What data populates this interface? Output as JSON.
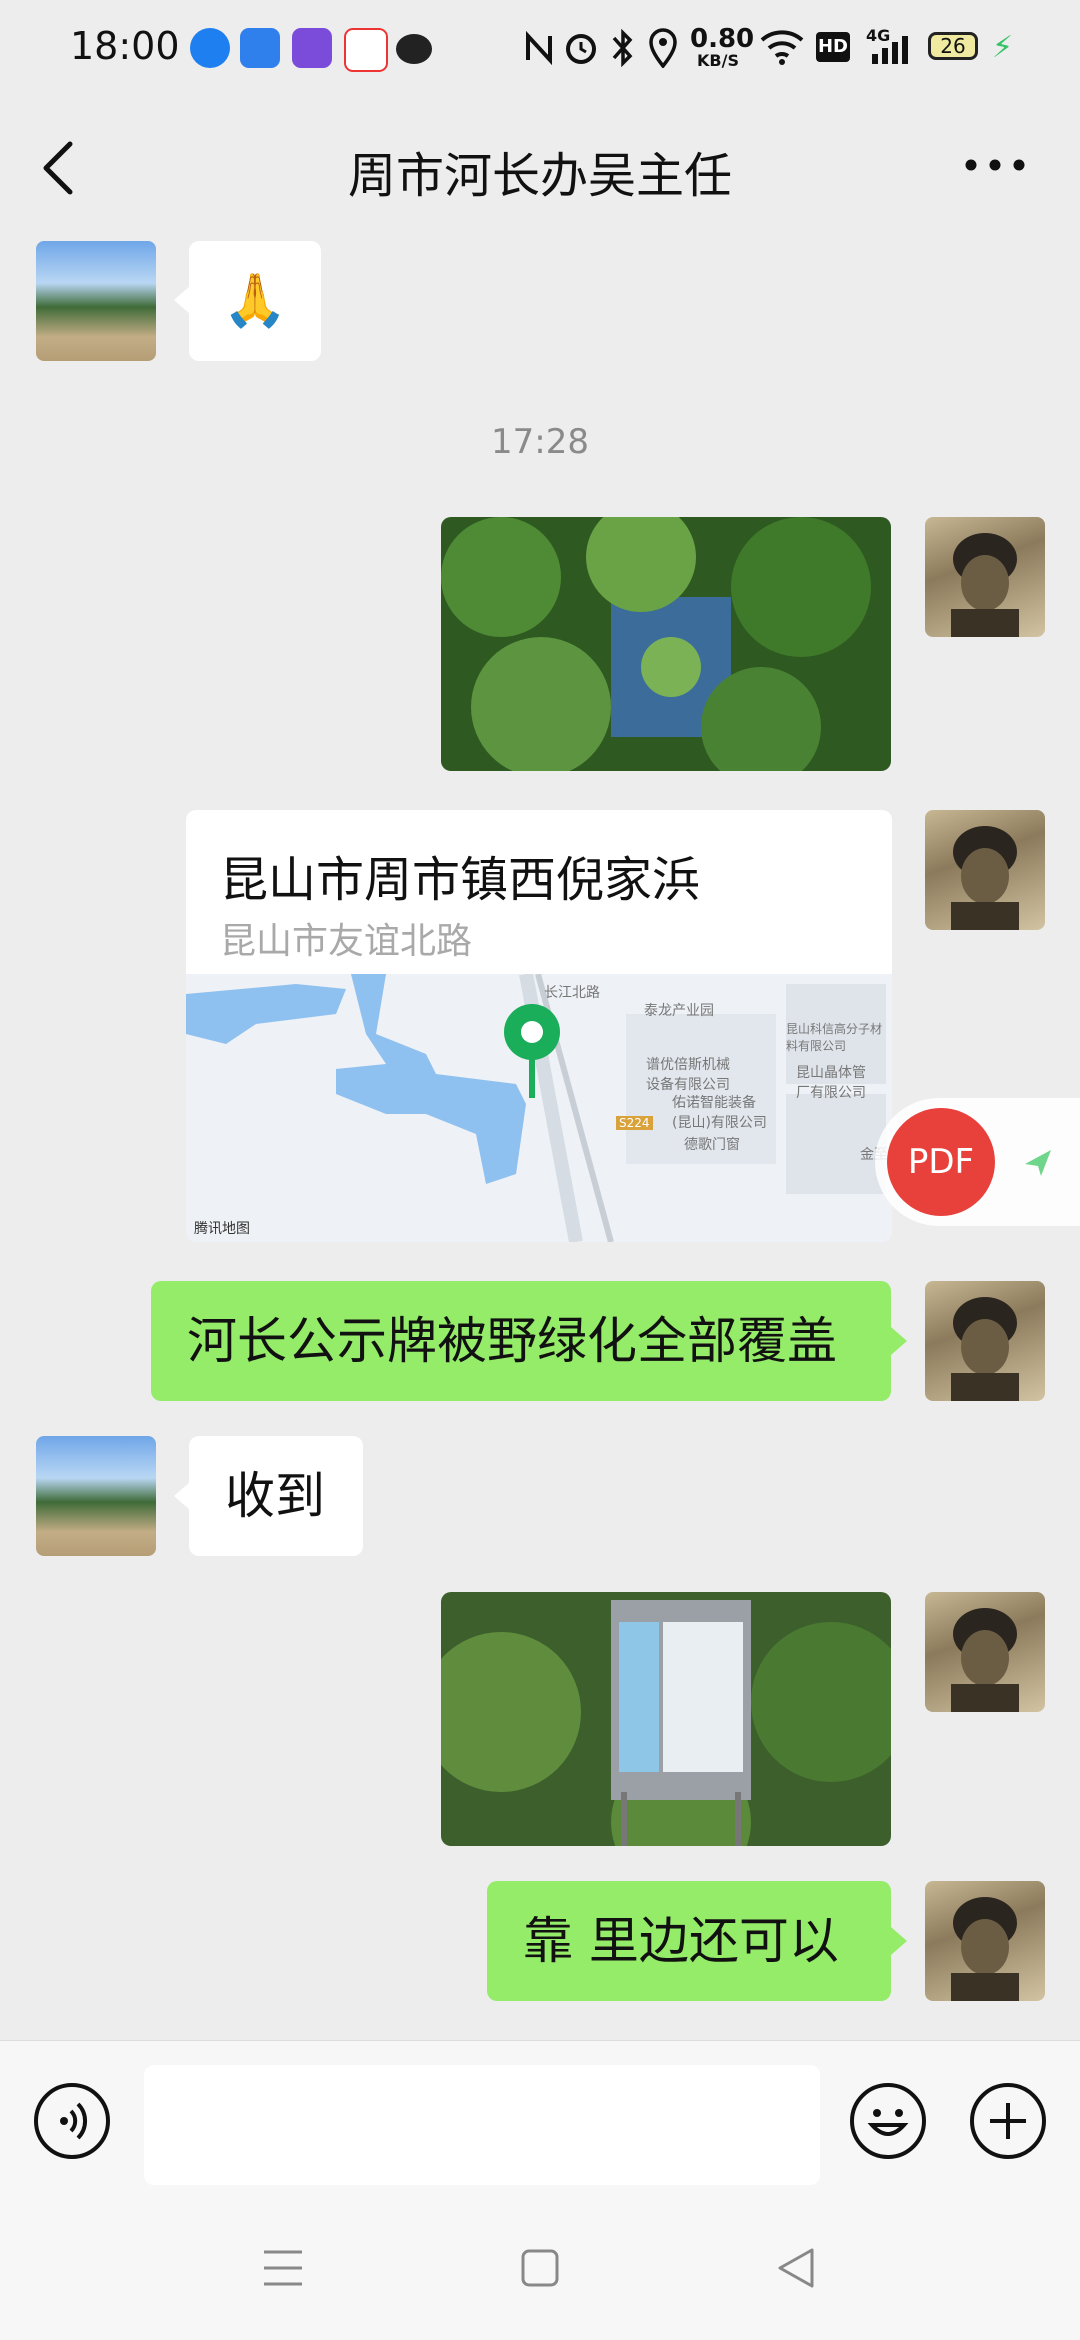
{
  "status_bar": {
    "time": "18:00",
    "network_speed_value": "0.80",
    "network_speed_unit": "KB/S",
    "hd_label": "HD",
    "signal_label": "4G",
    "battery": "26"
  },
  "header": {
    "title": "周市河长办吴主任",
    "back_icon": "chevron-left-icon",
    "more_icon": "more-horizontal-icon"
  },
  "messages": {
    "m1_emoji": "🙏",
    "time_divider": "17:28",
    "location": {
      "title": "昆山市周市镇西倪家浜",
      "subtitle": "昆山市友谊北路",
      "map_labels": {
        "road1": "长江北路",
        "industry": "泰龙产业园",
        "company1": "昆山科信高分子材料有限公司",
        "company2": "谱优倍斯机械设备有限公司",
        "company3": "昆山晶体管厂有限公司",
        "company4": "佑诺智能装备(昆山)有限公司",
        "road2": "S224",
        "shop": "德歌门窗",
        "other": "金至",
        "provider": "腾讯地图"
      }
    },
    "m_text1": "河长公示牌被野绿化全部覆盖",
    "m_reply": "收到",
    "m_text2": "靠 里边还可以"
  },
  "floating": {
    "pdf_label": "PDF"
  },
  "input_bar": {
    "voice_icon": "voice-icon",
    "emoji_icon": "emoji-icon",
    "plus_icon": "plus-icon"
  },
  "system_nav": {
    "menu_icon": "menu-icon",
    "home_icon": "home-square-icon",
    "back_icon": "back-triangle-icon"
  },
  "colors": {
    "background": "#ededed",
    "green_bubble": "#95ec69",
    "pdf_red": "#e8413c",
    "map_pin": "#1aad5a"
  }
}
